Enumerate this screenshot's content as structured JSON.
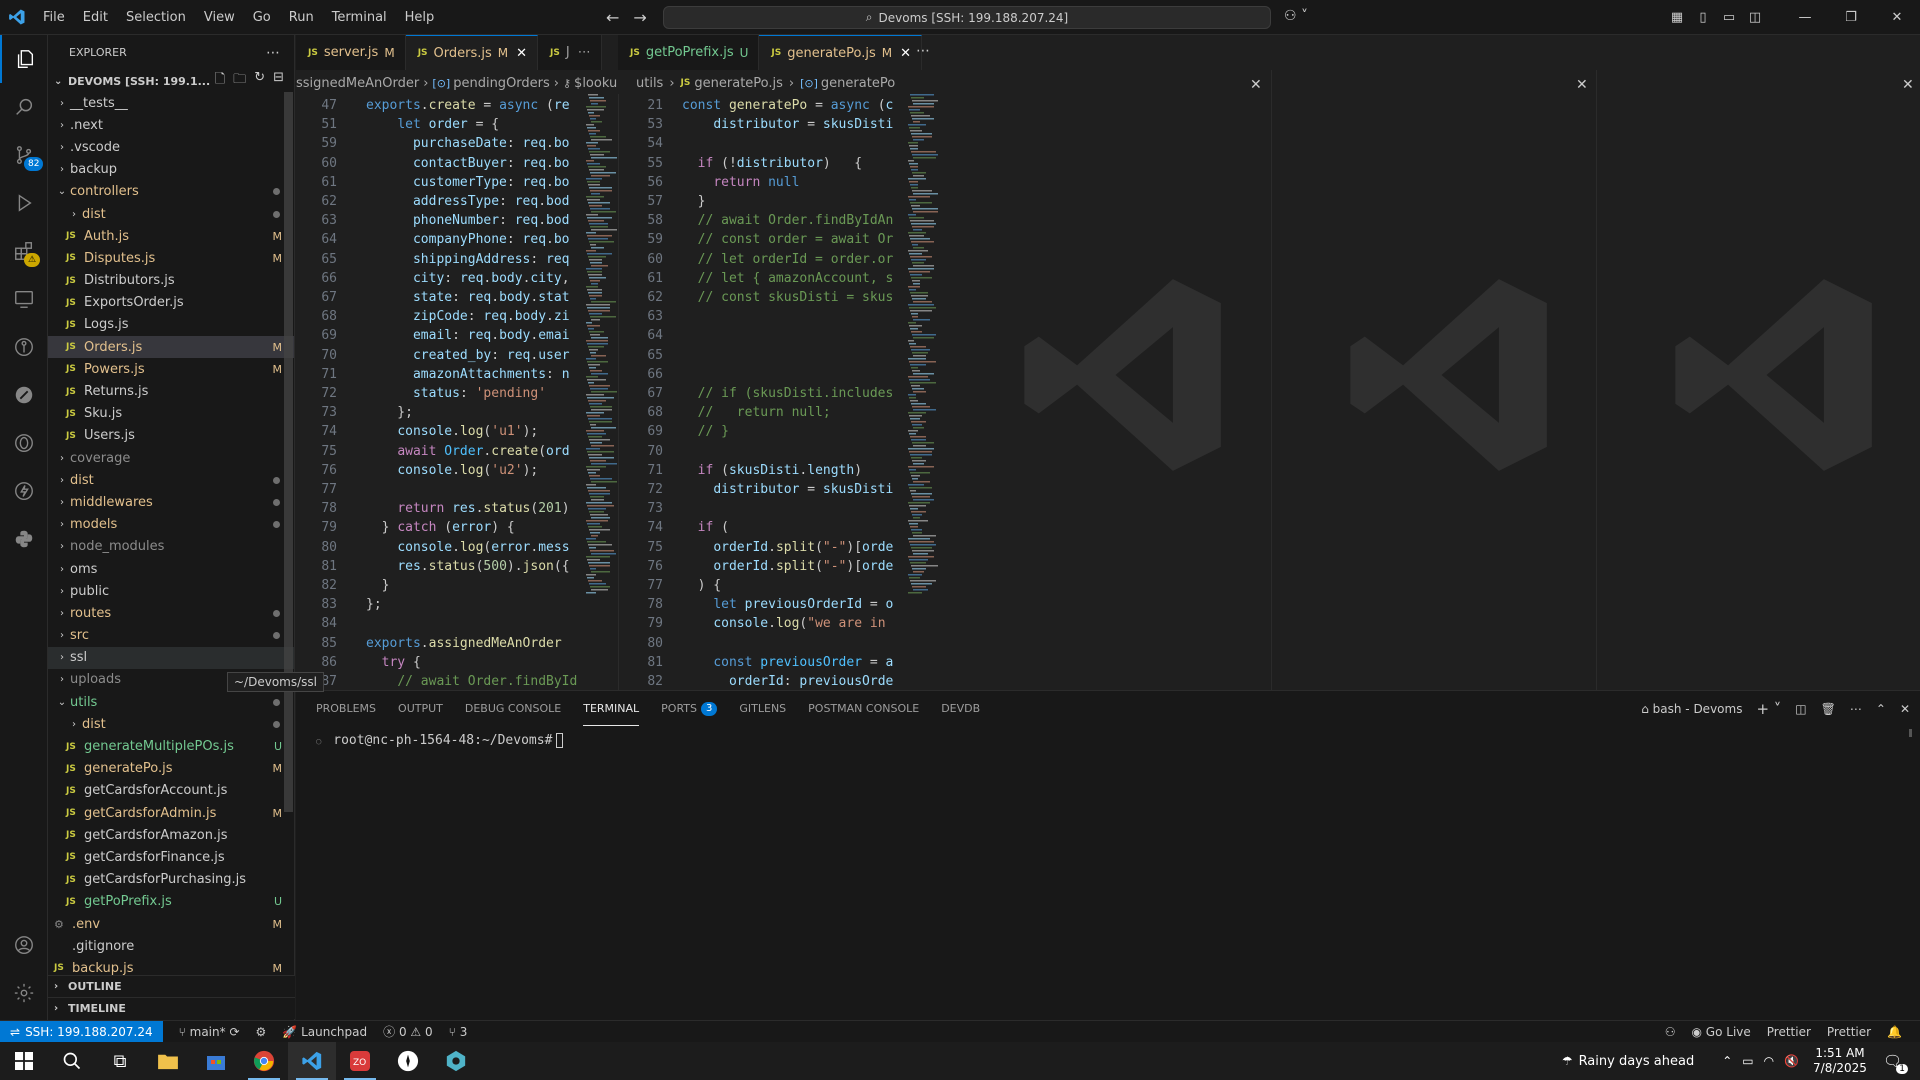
{
  "title_bar": {
    "menu": [
      "File",
      "Edit",
      "Selection",
      "View",
      "Go",
      "Run",
      "Terminal",
      "Help"
    ],
    "command_center": "Devoms [SSH: 199.188.207.24]",
    "icons": [
      "vscode-logo-icon",
      "back-arrow-icon",
      "forward-arrow-icon",
      "copilot-icon",
      "layout-icon",
      "sidebar-toggle-icon",
      "panel-toggle-icon",
      "secondary-sidebar-icon",
      "minimize-icon",
      "restore-icon",
      "close-icon"
    ]
  },
  "activity_bar": {
    "items": [
      {
        "name": "explorer-icon"
      },
      {
        "name": "search-icon"
      },
      {
        "name": "source-control-icon",
        "badge": "82"
      },
      {
        "name": "run-debug-icon"
      },
      {
        "name": "extensions-icon",
        "badge": "⚠"
      },
      {
        "name": "remote-explorer-icon"
      },
      {
        "name": "gitlens-icon"
      },
      {
        "name": "postman-icon"
      },
      {
        "name": "database-icon"
      },
      {
        "name": "thunder-client-icon"
      },
      {
        "name": "python-icon"
      }
    ],
    "bottom": [
      "account-icon",
      "settings-gear-icon"
    ]
  },
  "explorer": {
    "title": "EXPLORER",
    "root": "DEVOMS [SSH: 199.1...",
    "items": [
      {
        "label": "__tests__",
        "type": "folder",
        "indent": 1,
        "status": "",
        "dot": false
      },
      {
        "label": ".next",
        "type": "folder",
        "indent": 1,
        "status": "",
        "dot": false
      },
      {
        "label": ".vscode",
        "type": "folder",
        "indent": 1,
        "status": "",
        "dot": false
      },
      {
        "label": "backup",
        "type": "folder",
        "indent": 1,
        "status": "",
        "dot": false
      },
      {
        "label": "controllers",
        "type": "folder-open",
        "indent": 1,
        "status": "",
        "dot": true,
        "color": "mod"
      },
      {
        "label": "dist",
        "type": "folder",
        "indent": 2,
        "status": "",
        "dot": true,
        "color": "mod"
      },
      {
        "label": "Auth.js",
        "type": "js",
        "indent": 2,
        "status": "M",
        "color": "mod"
      },
      {
        "label": "Disputes.js",
        "type": "js",
        "indent": 2,
        "status": "M",
        "color": "mod"
      },
      {
        "label": "Distributors.js",
        "type": "js",
        "indent": 2,
        "status": ""
      },
      {
        "label": "ExportsOrder.js",
        "type": "js",
        "indent": 2,
        "status": ""
      },
      {
        "label": "Logs.js",
        "type": "js",
        "indent": 2,
        "status": ""
      },
      {
        "label": "Orders.js",
        "type": "js",
        "indent": 2,
        "status": "M",
        "color": "mod",
        "selected": true
      },
      {
        "label": "Powers.js",
        "type": "js",
        "indent": 2,
        "status": "M",
        "color": "mod"
      },
      {
        "label": "Returns.js",
        "type": "js",
        "indent": 2,
        "status": ""
      },
      {
        "label": "Sku.js",
        "type": "js",
        "indent": 2,
        "status": ""
      },
      {
        "label": "Users.js",
        "type": "js",
        "indent": 2,
        "status": ""
      },
      {
        "label": "coverage",
        "type": "folder",
        "indent": 1,
        "status": "",
        "color": "dim"
      },
      {
        "label": "dist",
        "type": "folder",
        "indent": 1,
        "status": "",
        "dot": true,
        "color": "mod"
      },
      {
        "label": "middlewares",
        "type": "folder",
        "indent": 1,
        "status": "",
        "dot": true,
        "color": "mod"
      },
      {
        "label": "models",
        "type": "folder",
        "indent": 1,
        "status": "",
        "dot": true,
        "color": "mod"
      },
      {
        "label": "node_modules",
        "type": "folder",
        "indent": 1,
        "status": "",
        "color": "dim"
      },
      {
        "label": "oms",
        "type": "folder",
        "indent": 1,
        "status": ""
      },
      {
        "label": "public",
        "type": "folder",
        "indent": 1,
        "status": ""
      },
      {
        "label": "routes",
        "type": "folder",
        "indent": 1,
        "status": "",
        "dot": true,
        "color": "mod"
      },
      {
        "label": "src",
        "type": "folder",
        "indent": 1,
        "status": "",
        "dot": true,
        "color": "mod"
      },
      {
        "label": "ssl",
        "type": "folder",
        "indent": 1,
        "status": "",
        "hover": true
      },
      {
        "label": "uploads",
        "type": "folder",
        "indent": 1,
        "status": "",
        "color": "dim"
      },
      {
        "label": "utils",
        "type": "folder-open",
        "indent": 1,
        "status": "",
        "dot": true,
        "color": "unt"
      },
      {
        "label": "dist",
        "type": "folder",
        "indent": 2,
        "status": "",
        "dot": true,
        "color": "mod"
      },
      {
        "label": "generateMultiplePOs.js",
        "type": "js",
        "indent": 2,
        "status": "U",
        "color": "unt"
      },
      {
        "label": "generatePo.js",
        "type": "js",
        "indent": 2,
        "status": "M",
        "color": "mod"
      },
      {
        "label": "getCardsforAccount.js",
        "type": "js",
        "indent": 2,
        "status": ""
      },
      {
        "label": "getCardsforAdmin.js",
        "type": "js",
        "indent": 2,
        "status": "M",
        "color": "mod"
      },
      {
        "label": "getCardsforAmazon.js",
        "type": "js",
        "indent": 2,
        "status": ""
      },
      {
        "label": "getCardsforFinance.js",
        "type": "js",
        "indent": 2,
        "status": ""
      },
      {
        "label": "getCardsforPurchasing.js",
        "type": "js",
        "indent": 2,
        "status": ""
      },
      {
        "label": "getPoPrefix.js",
        "type": "js",
        "indent": 2,
        "status": "U",
        "color": "unt"
      },
      {
        "label": ".env",
        "type": "gear",
        "indent": 1,
        "status": "M",
        "color": "mod"
      },
      {
        "label": ".gitignore",
        "type": "plain",
        "indent": 1,
        "status": ""
      },
      {
        "label": "backup.js",
        "type": "js",
        "indent": 1,
        "status": "M",
        "color": "mod"
      }
    ],
    "tooltip": "~/Devoms/ssl",
    "sections": [
      "OUTLINE",
      "TIMELINE"
    ]
  },
  "tabs_group1": [
    {
      "label": "server.js",
      "status": "M",
      "active": false
    },
    {
      "label": "Orders.js",
      "status": "M",
      "active": true
    },
    {
      "label": "J",
      "status": "",
      "active": false,
      "more": "⋯"
    }
  ],
  "tabs_group2": [
    {
      "label": "getPoPrefix.js",
      "status": "U",
      "active": false
    },
    {
      "label": "generatePo.js",
      "status": "M",
      "active": true
    }
  ],
  "breadcrumb1": [
    "ssignedMeAnOrder",
    "pendingOrders",
    "$lookup"
  ],
  "breadcrumb2": [
    "utils",
    "generatePo.js",
    "generatePo"
  ],
  "pane1_lines": [
    {
      "n": "47",
      "h": "<span class=\"kw\">exports</span>.<span class=\"fn\">create</span> = <span class=\"kw\">async</span> (<span class=\"vr\">re</span>"
    },
    {
      "n": "51",
      "h": "    <span class=\"kw\">let</span> <span class=\"vr\">order</span> = {"
    },
    {
      "n": "59",
      "h": "      <span class=\"vr\">purchaseDate</span>: <span class=\"vr\">req</span>.<span class=\"vr\">bo</span>"
    },
    {
      "n": "60",
      "h": "      <span class=\"vr\">contactBuyer</span>: <span class=\"vr\">req</span>.<span class=\"vr\">bo</span>"
    },
    {
      "n": "61",
      "h": "      <span class=\"vr\">customerType</span>: <span class=\"vr\">req</span>.<span class=\"vr\">bo</span>"
    },
    {
      "n": "62",
      "h": "      <span class=\"vr\">addressType</span>: <span class=\"vr\">req</span>.<span class=\"vr\">bod</span>"
    },
    {
      "n": "63",
      "h": "      <span class=\"vr\">phoneNumber</span>: <span class=\"vr\">req</span>.<span class=\"vr\">bod</span>"
    },
    {
      "n": "64",
      "h": "      <span class=\"vr\">companyPhone</span>: <span class=\"vr\">req</span>.<span class=\"vr\">bo</span>"
    },
    {
      "n": "65",
      "h": "      <span class=\"vr\">shippingAddress</span>: <span class=\"vr\">req</span>"
    },
    {
      "n": "66",
      "h": "      <span class=\"vr\">city</span>: <span class=\"vr\">req</span>.<span class=\"vr\">body</span>.<span class=\"vr\">city</span>,"
    },
    {
      "n": "67",
      "h": "      <span class=\"vr\">state</span>: <span class=\"vr\">req</span>.<span class=\"vr\">body</span>.<span class=\"vr\">stat</span>"
    },
    {
      "n": "68",
      "h": "      <span class=\"vr\">zipCode</span>: <span class=\"vr\">req</span>.<span class=\"vr\">body</span>.<span class=\"vr\">zi</span>"
    },
    {
      "n": "69",
      "h": "      <span class=\"vr\">email</span>: <span class=\"vr\">req</span>.<span class=\"vr\">body</span>.<span class=\"vr\">emai</span>"
    },
    {
      "n": "70",
      "h": "      <span class=\"vr\">created_by</span>: <span class=\"vr\">req</span>.<span class=\"vr\">user</span>"
    },
    {
      "n": "71",
      "h": "      <span class=\"vr\">amazonAttachments</span>: <span class=\"vr\">n</span>"
    },
    {
      "n": "72",
      "h": "      <span class=\"vr\">status</span>: <span class=\"str\">'pending'</span>"
    },
    {
      "n": "73",
      "h": "    };"
    },
    {
      "n": "74",
      "h": "    <span class=\"vr\">console</span>.<span class=\"fn\">log</span>(<span class=\"str\">'u1'</span>);"
    },
    {
      "n": "75",
      "h": "    <span class=\"kc\">await</span> <span class=\"cn\">Order</span>.<span class=\"fn\">create</span>(<span class=\"vr\">ord</span>"
    },
    {
      "n": "76",
      "h": "    <span class=\"vr\">console</span>.<span class=\"fn\">log</span>(<span class=\"str\">'u2'</span>);"
    },
    {
      "n": "77",
      "h": ""
    },
    {
      "n": "78",
      "h": "    <span class=\"kc\">return</span> <span class=\"vr\">res</span>.<span class=\"fn\">status</span>(<span class=\"nm\">201</span>)"
    },
    {
      "n": "79",
      "h": "  } <span class=\"kc\">catch</span> (<span class=\"vr\">error</span>) {"
    },
    {
      "n": "80",
      "h": "    <span class=\"vr\">console</span>.<span class=\"fn\">log</span>(<span class=\"vr\">error</span>.<span class=\"vr\">mess</span>"
    },
    {
      "n": "81",
      "h": "    <span class=\"vr\">res</span>.<span class=\"fn\">status</span>(<span class=\"nm\">500</span>).<span class=\"fn\">json</span>({"
    },
    {
      "n": "82",
      "h": "  }"
    },
    {
      "n": "83",
      "h": "};"
    },
    {
      "n": "84",
      "h": ""
    },
    {
      "n": "85",
      "h": "<span class=\"kw\">exports</span>.<span class=\"fn\">assignedMeAnOrder</span>"
    },
    {
      "n": "86",
      "h": "  <span class=\"kc\">try</span> {"
    },
    {
      "n": "87",
      "h": "    <span class=\"cm\">// await Order.findById</span>"
    }
  ],
  "pane2_lines": [
    {
      "n": "21",
      "h": "<span class=\"kw\">const</span> <span class=\"fn\">generatePo</span> = <span class=\"kw\">async</span> (<span class=\"vr\">c</span>"
    },
    {
      "n": "53",
      "h": "    <span class=\"vr\">distributor</span> = <span class=\"vr\">skusDisti</span>"
    },
    {
      "n": "54",
      "h": ""
    },
    {
      "n": "55",
      "h": "  <span class=\"kc\">if</span> (!<span class=\"vr\">distributor</span>)   {"
    },
    {
      "n": "56",
      "h": "    <span class=\"kc\">return</span> <span class=\"kw\">null</span>"
    },
    {
      "n": "57",
      "h": "  }"
    },
    {
      "n": "58",
      "h": "  <span class=\"cm\">// await Order.findByIdAn</span>"
    },
    {
      "n": "59",
      "h": "  <span class=\"cm\">// const order = await Or</span>"
    },
    {
      "n": "60",
      "h": "  <span class=\"cm\">// let orderId = order.or</span>"
    },
    {
      "n": "61",
      "h": "  <span class=\"cm\">// let { amazonAccount, s</span>"
    },
    {
      "n": "62",
      "h": "  <span class=\"cm\">// const skusDisti = skus</span>"
    },
    {
      "n": "63",
      "h": ""
    },
    {
      "n": "64",
      "h": ""
    },
    {
      "n": "65",
      "h": ""
    },
    {
      "n": "66",
      "h": ""
    },
    {
      "n": "67",
      "h": "  <span class=\"cm\">// if (skusDisti.includes</span>"
    },
    {
      "n": "68",
      "h": "  <span class=\"cm\">//   return null;</span>"
    },
    {
      "n": "69",
      "h": "  <span class=\"cm\">// }</span>"
    },
    {
      "n": "70",
      "h": ""
    },
    {
      "n": "71",
      "h": "  <span class=\"kc\">if</span> (<span class=\"vr\">skusDisti</span>.<span class=\"vr\">length</span>)"
    },
    {
      "n": "72",
      "h": "    <span class=\"vr\">distributor</span> = <span class=\"vr\">skusDisti</span>"
    },
    {
      "n": "73",
      "h": ""
    },
    {
      "n": "74",
      "h": "  <span class=\"kc\">if</span> ("
    },
    {
      "n": "75",
      "h": "    <span class=\"vr\">orderId</span>.<span class=\"fn\">split</span>(<span class=\"str\">\"-\"</span>)[<span class=\"vr\">orde</span>"
    },
    {
      "n": "76",
      "h": "    <span class=\"vr\">orderId</span>.<span class=\"fn\">split</span>(<span class=\"str\">\"-\"</span>)[<span class=\"vr\">orde</span>"
    },
    {
      "n": "77",
      "h": "  ) {"
    },
    {
      "n": "78",
      "h": "    <span class=\"kw\">let</span> <span class=\"vr\">previousOrderId</span> = <span class=\"vr\">o</span>"
    },
    {
      "n": "79",
      "h": "    <span class=\"vr\">console</span>.<span class=\"fn\">log</span>(<span class=\"str\">\"we are in</span>"
    },
    {
      "n": "80",
      "h": ""
    },
    {
      "n": "81",
      "h": "    <span class=\"kw\">const</span> <span class=\"cn\">previousOrder</span> = <span class=\"vr\">a</span>"
    },
    {
      "n": "82",
      "h": "      <span class=\"vr\">orderId</span>: <span class=\"vr\">previousOrde</span>"
    }
  ],
  "panel": {
    "tabs": [
      {
        "label": "PROBLEMS"
      },
      {
        "label": "OUTPUT"
      },
      {
        "label": "DEBUG CONSOLE"
      },
      {
        "label": "TERMINAL",
        "active": true
      },
      {
        "label": "PORTS",
        "badge": "3"
      },
      {
        "label": "GITLENS"
      },
      {
        "label": "POSTMAN CONSOLE"
      },
      {
        "label": "DEVDB"
      }
    ],
    "shell": "bash - Devoms",
    "prompt": "root@nc-ph-1564-48:~/Devoms#"
  },
  "status_bar": {
    "remote": "SSH: 199.188.207.24",
    "branch": "main*",
    "launchpad": "Launchpad",
    "errors": "0",
    "warnings": "0",
    "ports": "3",
    "golive": "Go Live",
    "prettier1": "Prettier",
    "prettier2": "Prettier"
  },
  "taskbar": {
    "weather": "Rainy days ahead",
    "time": "1:51 AM",
    "date": "7/8/2025",
    "notif": "1"
  },
  "colors": {
    "accent": "#0078d4",
    "modified": "#e2c08d",
    "untracked": "#73c991"
  }
}
